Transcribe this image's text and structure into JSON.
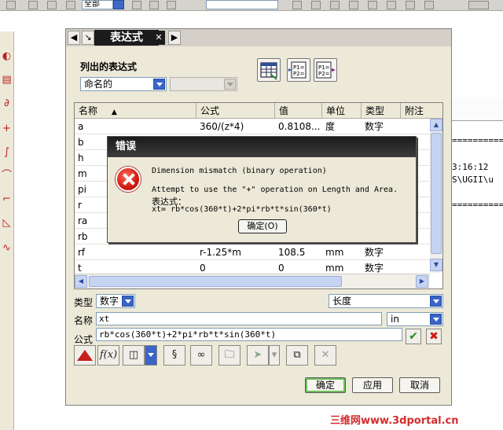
{
  "toolbar": {
    "combo_value": "全部"
  },
  "dialog": {
    "title": "表达式",
    "list_group_label": "列出的表达式",
    "list_filter": "命名的",
    "list_filter2": "",
    "btn_p1_a": "P1=\nP2=",
    "btn_p1_b": "P1=\nP2=",
    "columns": [
      "名称",
      "公式",
      "值",
      "单位",
      "类型",
      "附注"
    ],
    "rows": [
      {
        "name": "a",
        "formula": "360/(z*4)",
        "value": "0.8108...",
        "unit": "度",
        "type": "数字"
      },
      {
        "name": "b",
        "formula": "",
        "value": "",
        "unit": "",
        "type": ""
      },
      {
        "name": "h",
        "formula": "",
        "value": "",
        "unit": "",
        "type": ""
      },
      {
        "name": "m",
        "formula": "",
        "value": "",
        "unit": "",
        "type": ""
      },
      {
        "name": "pi",
        "formula": "",
        "value": "",
        "unit": "",
        "type": ""
      },
      {
        "name": "r",
        "formula": "",
        "value": "",
        "unit": "",
        "type": ""
      },
      {
        "name": "ra",
        "formula": "",
        "value": "",
        "unit": "",
        "type": ""
      },
      {
        "name": "rb",
        "formula": "",
        "value": "",
        "unit": "",
        "type": ""
      },
      {
        "name": "rf",
        "formula": "r-1.25*m",
        "value": "108.5",
        "unit": "mm",
        "type": "数字"
      },
      {
        "name": "t",
        "formula": "0",
        "value": "0",
        "unit": "mm",
        "type": "数字"
      }
    ],
    "type_label": "类型",
    "type_value": "数字",
    "dim_value": "长度",
    "name_label": "名称",
    "name_value": "xt",
    "unit_value": "in",
    "formula_label": "公式",
    "formula_value": "rb*cos(360*t)+2*pi*rb*t*sin(360*t)",
    "tool_fx": "f(x)",
    "ok": "确定",
    "apply": "应用",
    "cancel": "取消"
  },
  "error": {
    "title": "错误",
    "line1": "Dimension mismatch (binary operation)",
    "line2": "Attempt to use the \"+\" operation on Length and Area.",
    "line3": "表达式：",
    "line4": " xt= rb*cos(360*t)+2*pi*rb*t*sin(360*t)",
    "ok": "确定(O)"
  },
  "background": {
    "l1": "==========",
    "l2": "3:16:12",
    "l3": "S\\UGII\\u",
    "l4": "=========="
  },
  "watermark": "三维网www.3dportal.cn",
  "colors": {
    "accent": "#3a64c8",
    "error": "#d01a10",
    "watermark": "#d42b2b"
  }
}
